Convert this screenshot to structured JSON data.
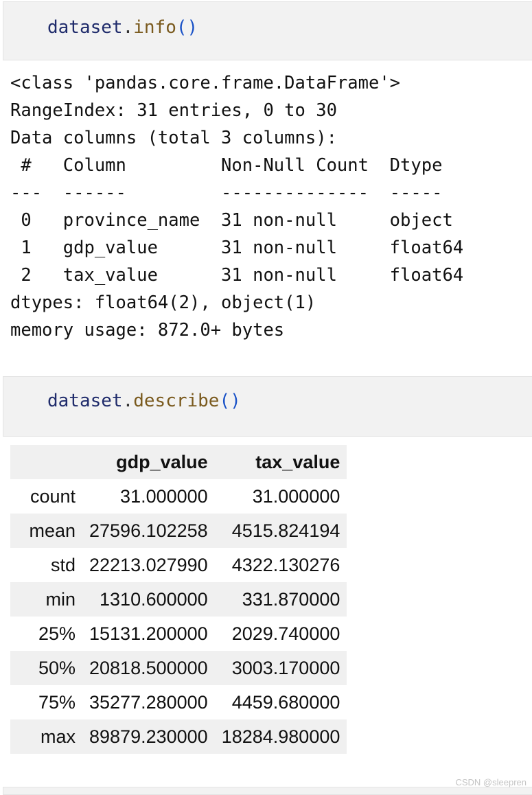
{
  "cells": [
    {
      "code": {
        "obj": "dataset",
        "dot": ".",
        "method": "info",
        "parens": "()"
      }
    },
    {
      "code": {
        "obj": "dataset",
        "dot": ".",
        "method": "describe",
        "parens": "()"
      }
    }
  ],
  "info_output": {
    "lines": [
      "<class 'pandas.core.frame.DataFrame'>",
      "RangeIndex: 31 entries, 0 to 30",
      "Data columns (total 3 columns):",
      " #   Column         Non-Null Count  Dtype  ",
      "---  ------         --------------  -----  ",
      " 0   province_name  31 non-null     object ",
      " 1   gdp_value      31 non-null     float64",
      " 2   tax_value      31 non-null     float64",
      "dtypes: float64(2), object(1)",
      "memory usage: 872.0+ bytes"
    ]
  },
  "describe_table": {
    "headers": [
      "",
      "gdp_value",
      "tax_value"
    ],
    "rows": [
      {
        "label": "count",
        "gdp_value": "31.000000",
        "tax_value": "31.000000"
      },
      {
        "label": "mean",
        "gdp_value": "27596.102258",
        "tax_value": "4515.824194"
      },
      {
        "label": "std",
        "gdp_value": "22213.027990",
        "tax_value": "4322.130276"
      },
      {
        "label": "min",
        "gdp_value": "1310.600000",
        "tax_value": "331.870000"
      },
      {
        "label": "25%",
        "gdp_value": "15131.200000",
        "tax_value": "2029.740000"
      },
      {
        "label": "50%",
        "gdp_value": "20818.500000",
        "tax_value": "3003.170000"
      },
      {
        "label": "75%",
        "gdp_value": "35277.280000",
        "tax_value": "4459.680000"
      },
      {
        "label": "max",
        "gdp_value": "89879.230000",
        "tax_value": "18284.980000"
      }
    ]
  },
  "watermark": "CSDN @sleepren"
}
